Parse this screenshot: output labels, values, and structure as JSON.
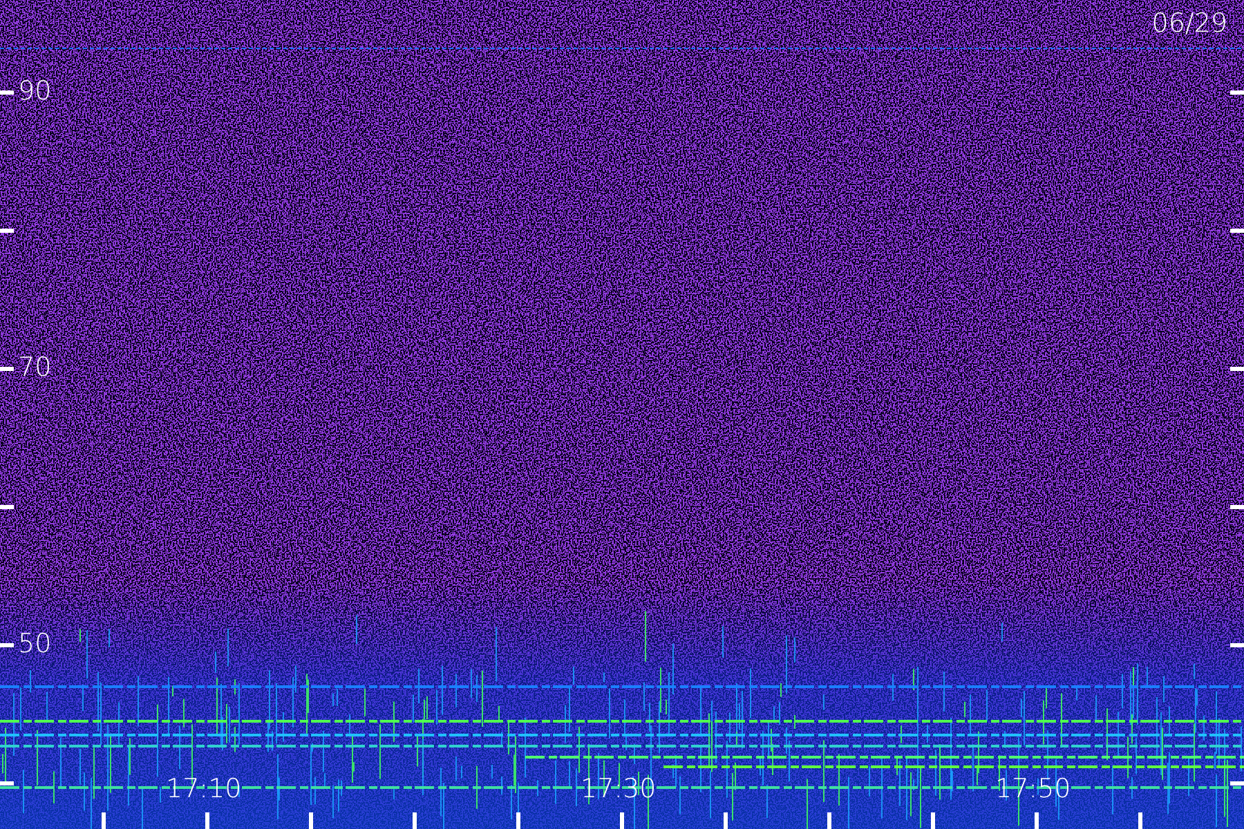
{
  "date": "06/29",
  "y_axis": {
    "labels": [
      "90",
      "70",
      "50"
    ]
  },
  "x_axis": {
    "labels": [
      "17:10",
      "17:30",
      "17:50"
    ]
  }
}
